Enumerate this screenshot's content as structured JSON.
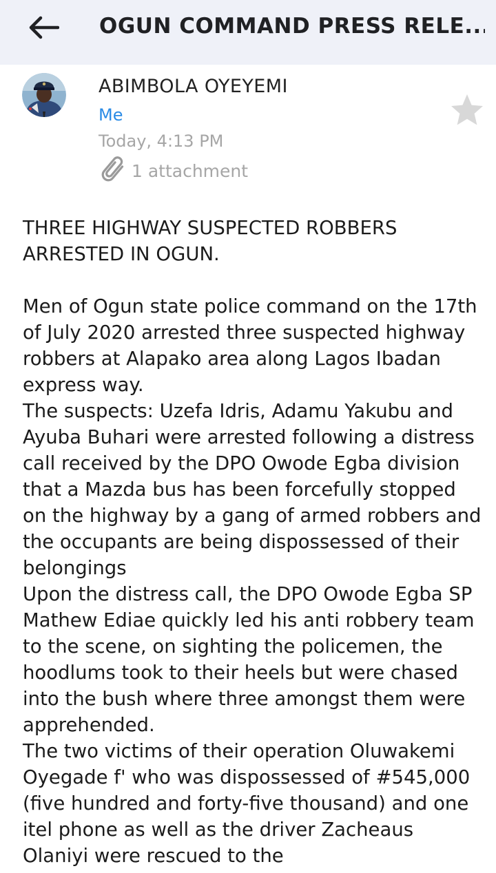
{
  "header": {
    "title": "OGUN COMMAND PRESS RELE...",
    "back_icon": "arrow-left-icon"
  },
  "message": {
    "sender": "ABIMBOLA OYEYEMI",
    "recipient": "Me",
    "time": "Today, 4:13 PM",
    "attachment_label": "1 attachment",
    "starred": false,
    "colors": {
      "link": "#2a8be6",
      "muted": "#a6a6a6",
      "header_bg": "#eff1f8"
    }
  },
  "body": {
    "heading": "THREE HIGHWAY SUSPECTED ROBBERS ARRESTED IN OGUN.",
    "paragraphs": [
      "Men of Ogun state police command on the 17th of July 2020 arrested three suspected highway robbers at Alapako area along Lagos Ibadan express way.",
      "The suspects: Uzefa Idris, Adamu Yakubu and Ayuba Buhari were arrested following a distress call received by the DPO Owode Egba division that a Mazda bus has been forcefully stopped on the highway by a gang of armed robbers and the occupants are being dispossessed of their belongings",
      "Upon the distress call, the DPO Owode Egba SP Mathew Ediae quickly led his anti robbery team to the scene, on sighting the policemen, the hoodlums took to their heels but were chased into the bush where three amongst them were apprehended.",
      "The two victims of their operation Oluwakemi Oyegade f' who was dispossessed of #545,000 (five hundred and forty-five thousand) and one itel phone as well as the driver Zacheaus Olaniyi were rescued to the"
    ]
  }
}
